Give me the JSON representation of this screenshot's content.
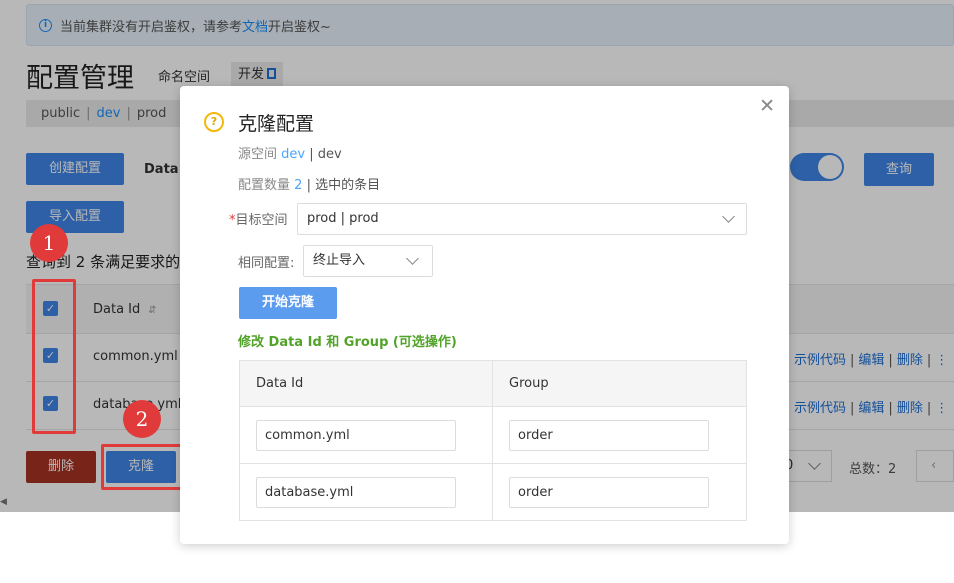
{
  "notice": {
    "text_before": "当前集群没有开启鉴权，请参考",
    "link": "文档",
    "text_after": "开启鉴权~"
  },
  "page": {
    "title": "配置管理",
    "namespace_label": "命名空间",
    "namespace_tag": "开发",
    "namespaces": [
      "public",
      "dev",
      "prod"
    ],
    "create_button": "创建配置",
    "import_button": "导入配置",
    "data_id_label": "Data I",
    "query_button": "查询",
    "result_text": "查询到 2 条满足要求的"
  },
  "table": {
    "header_data_id": "Data Id",
    "rows": [
      {
        "data_id": "common.yml",
        "ops": [
          "示例代码",
          "编辑",
          "删除"
        ]
      },
      {
        "data_id": "database.yml",
        "ops": [
          "示例代码",
          "编辑",
          "删除"
        ]
      }
    ]
  },
  "footer": {
    "delete_button": "删除",
    "clone_button": "克隆",
    "page_size": "0",
    "total": "总数：2"
  },
  "annotations": {
    "step1": "1",
    "step2": "2"
  },
  "modal": {
    "title": "克隆配置",
    "source_label": "源空间",
    "source_value": "dev",
    "source_suffix": "| dev",
    "count_label": "配置数量",
    "count_value": "2",
    "count_suffix": "| 选中的条目",
    "target_label": "目标空间",
    "target_value": "prod | prod",
    "same_label": "相同配置:",
    "same_value": "终止导入",
    "start_button": "开始克隆",
    "modify_label": "修改 Data Id 和 Group (可选操作)",
    "col_data_id": "Data Id",
    "col_group": "Group",
    "rows": [
      {
        "data_id": "common.yml",
        "group": "order"
      },
      {
        "data_id": "database.yml",
        "group": "order"
      }
    ]
  },
  "colors": {
    "primary": "#3f86e6",
    "danger": "#a83222",
    "link": "#1b6fd6",
    "success": "#52a32a",
    "annotation": "#e03a3a"
  }
}
